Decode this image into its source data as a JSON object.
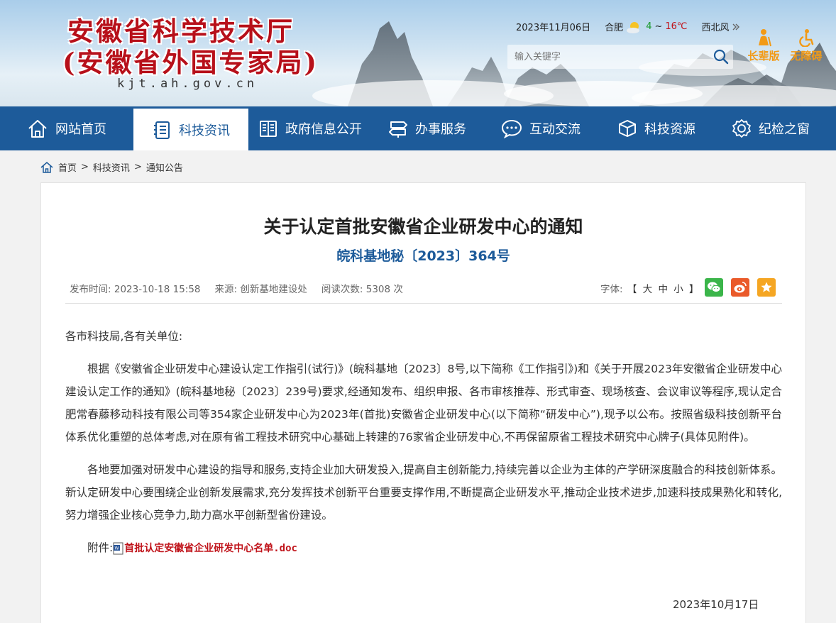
{
  "header": {
    "title_line1": "安徽省科学技术厅",
    "title_line2": "(安徽省外国专家局)",
    "domain": "kjt.ah.gov.cn",
    "date": "2023年11月06日",
    "city": "合肥",
    "temp_low": "4",
    "temp_sep": "~",
    "temp_high": "16℃",
    "wind": "西北风",
    "wind_icon": "double-chevron-right-icon",
    "search_placeholder": "输入关键字",
    "elder_label": "长辈版",
    "accessible_label": "无障碍"
  },
  "nav": {
    "items": [
      {
        "label": "网站首页",
        "icon": "home-icon"
      },
      {
        "label": "科技资讯",
        "icon": "news-icon"
      },
      {
        "label": "政府信息公开",
        "icon": "book-icon"
      },
      {
        "label": "办事服务",
        "icon": "signpost-icon"
      },
      {
        "label": "互动交流",
        "icon": "chat-icon"
      },
      {
        "label": "科技资源",
        "icon": "cube-icon"
      },
      {
        "label": "纪检之窗",
        "icon": "badge-icon"
      }
    ],
    "active_index": 1
  },
  "breadcrumb": {
    "items": [
      "首页",
      "科技资讯",
      "通知公告"
    ],
    "separator": ">"
  },
  "article": {
    "title": "关于认定首批安徽省企业研发中心的通知",
    "doc_number": "皖科基地秘〔2023〕364号",
    "publish_label": "发布时间:",
    "publish_time": "2023-10-18 15:58",
    "source_label": "来源:",
    "source": "创新基地建设处",
    "views_label": "阅读次数:",
    "views": "5308 次",
    "font_label": "字体:",
    "font_open": "【",
    "font_large": "大",
    "font_medium": "中",
    "font_small": "小",
    "font_close": "】",
    "share": {
      "wechat_color": "#3bb54a",
      "weibo_color": "#ea5a2a",
      "favorite_color": "#f5a623"
    },
    "salutation": "各市科技局,各有关单位:",
    "paragraphs": [
      "根据《安徽省企业研发中心建设认定工作指引(试行)》(皖科基地〔2023〕8号,以下简称《工作指引》)和《关于开展2023年安徽省企业研发中心建设认定工作的通知》(皖科基地秘〔2023〕239号)要求,经通知发布、组织申报、各市审核推荐、形式审查、现场核查、会议审议等程序,现认定合肥常春藤移动科技有限公司等354家企业研发中心为2023年(首批)安徽省企业研发中心(以下简称“研发中心”),现予以公布。按照省级科技创新平台体系优化重塑的总体考虑,对在原有省工程技术研究中心基础上转建的76家省企业研发中心,不再保留原省工程技术研究中心牌子(具体见附件)。",
      "各地要加强对研发中心建设的指导和服务,支持企业加大研发投入,提高自主创新能力,持续完善以企业为主体的产学研深度融合的科技创新体系。新认定研发中心要围绕企业创新发展需求,充分发挥技术创新平台重要支撑作用,不断提高企业研发水平,推动企业技术进步,加速科技成果熟化和转化,努力增强企业核心竞争力,助力高水平创新型省份建设。"
    ],
    "attachment_label": "附件:",
    "attachment_name": "首批认定安徽省企业研发中心名单.doc",
    "sign_date": "2023年10月17日"
  }
}
